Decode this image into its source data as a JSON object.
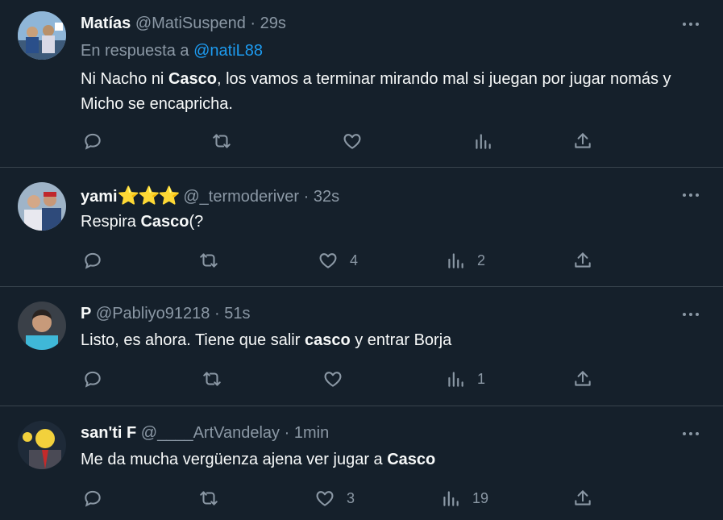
{
  "tweets": [
    {
      "name": "Matías",
      "stars": "",
      "handle": "@MatiSuspend",
      "dot": "·",
      "time": "29s",
      "reply_prefix": "En respuesta a",
      "reply_handle": "@natiL88",
      "text": {
        "p1": "Ni Nacho ni ",
        "bold": "Casco",
        "p2": ", los vamos a terminar mirando mal si juegan por jugar nomás y Micho se encapricha."
      },
      "likes": "",
      "views": ""
    },
    {
      "name": "yami",
      "stars": "⭐⭐⭐",
      "handle": "@_termoderiver",
      "dot": "·",
      "time": "32s",
      "text": {
        "p1": "Respira ",
        "bold": "Casco",
        "p2": "(?"
      },
      "likes": "4",
      "views": "2"
    },
    {
      "name": "P",
      "stars": "",
      "handle": "@Pabliyo91218",
      "dot": "·",
      "time": "51s",
      "text": {
        "p1": "Listo, es ahora. Tiene que salir ",
        "bold": "casco",
        "p2": " y entrar Borja"
      },
      "likes": "",
      "views": "1"
    },
    {
      "name": "san'ti F",
      "stars": "",
      "handle": "@____ArtVandelay",
      "dot": "·",
      "time": "1min",
      "text": {
        "p1": "Me da mucha vergüenza ajena ver jugar a ",
        "bold": "Casco",
        "p2": ""
      },
      "likes": "3",
      "views": "19"
    }
  ],
  "icons": {
    "reply": "reply-icon",
    "retweet": "retweet-icon",
    "like": "heart-icon",
    "views": "views-icon",
    "share": "share-icon",
    "more": "more-icon"
  },
  "colors": {
    "background": "#15202b",
    "text": "#f7f9f9",
    "muted": "#8b98a5",
    "link": "#1d9bf0",
    "divider": "#38444d"
  }
}
